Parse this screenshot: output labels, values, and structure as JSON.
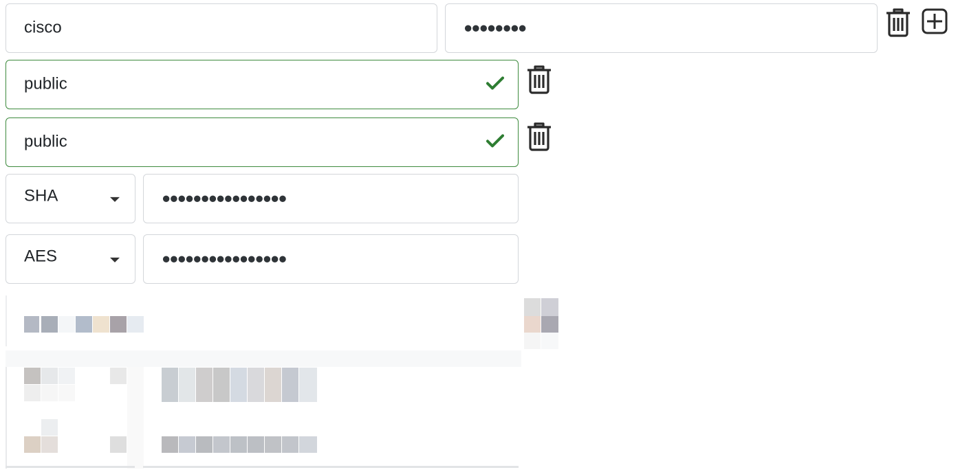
{
  "community_row": {
    "name_value": "cisco",
    "secret_value": "●●●●●●●●"
  },
  "read_community": {
    "value": "public"
  },
  "write_community": {
    "value": "public"
  },
  "auth": {
    "protocol": "SHA",
    "password": "●●●●●●●●●●●●●●●●"
  },
  "privacy": {
    "protocol": "AES",
    "password": "●●●●●●●●●●●●●●●●"
  },
  "icons": {
    "delete": "trash-icon",
    "add": "plus-square-icon",
    "valid": "check-icon",
    "dropdown": "caret-down-icon"
  },
  "colors": {
    "valid_border": "#3d8a3d",
    "valid_check": "#2e7d32",
    "default_border": "#d3d6da"
  }
}
